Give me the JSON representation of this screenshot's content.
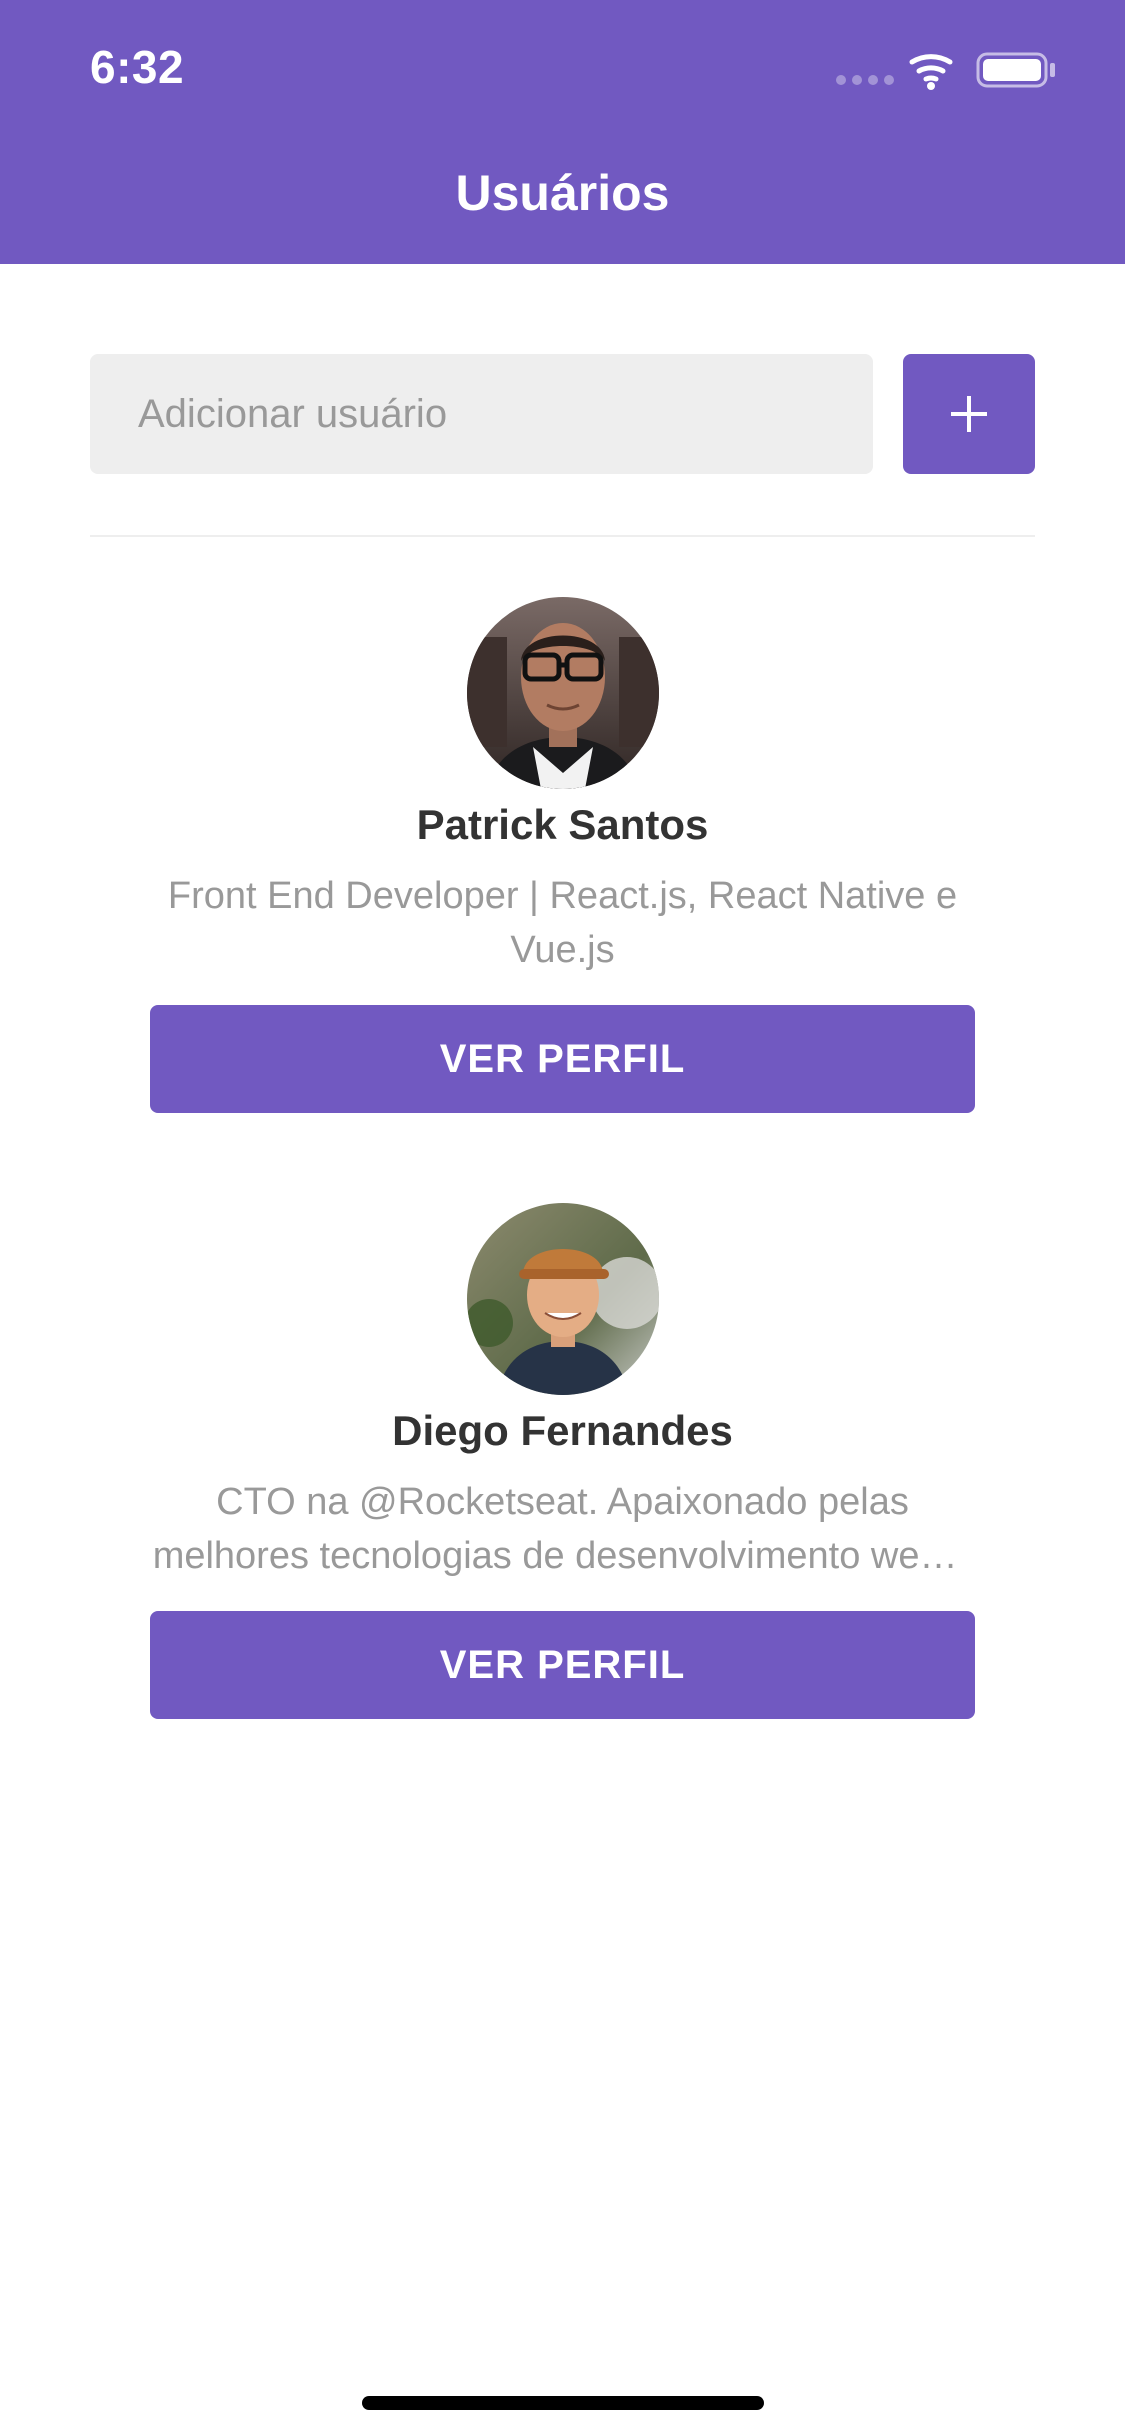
{
  "status_bar": {
    "time": "6:32",
    "icons": [
      "signal-dots-icon",
      "wifi-icon",
      "battery-icon"
    ]
  },
  "header": {
    "title": "Usuários"
  },
  "form": {
    "placeholder": "Adicionar usuário",
    "value": "",
    "add_icon": "plus-icon"
  },
  "users": [
    {
      "name": "Patrick Santos",
      "bio": "Front End Developer | React.js, React Native e Vue.js",
      "button_label": "VER PERFIL"
    },
    {
      "name": "Diego Fernandes",
      "bio": "CTO na @Rocketseat. Apaixonado pelas melhores tecnologias de desenvolvimento web e mobile.",
      "button_label": "VER PERFIL"
    }
  ],
  "colors": {
    "primary": "#7159c1",
    "input_background": "#eeeeee",
    "name_text": "#333333",
    "bio_text": "#999999"
  }
}
